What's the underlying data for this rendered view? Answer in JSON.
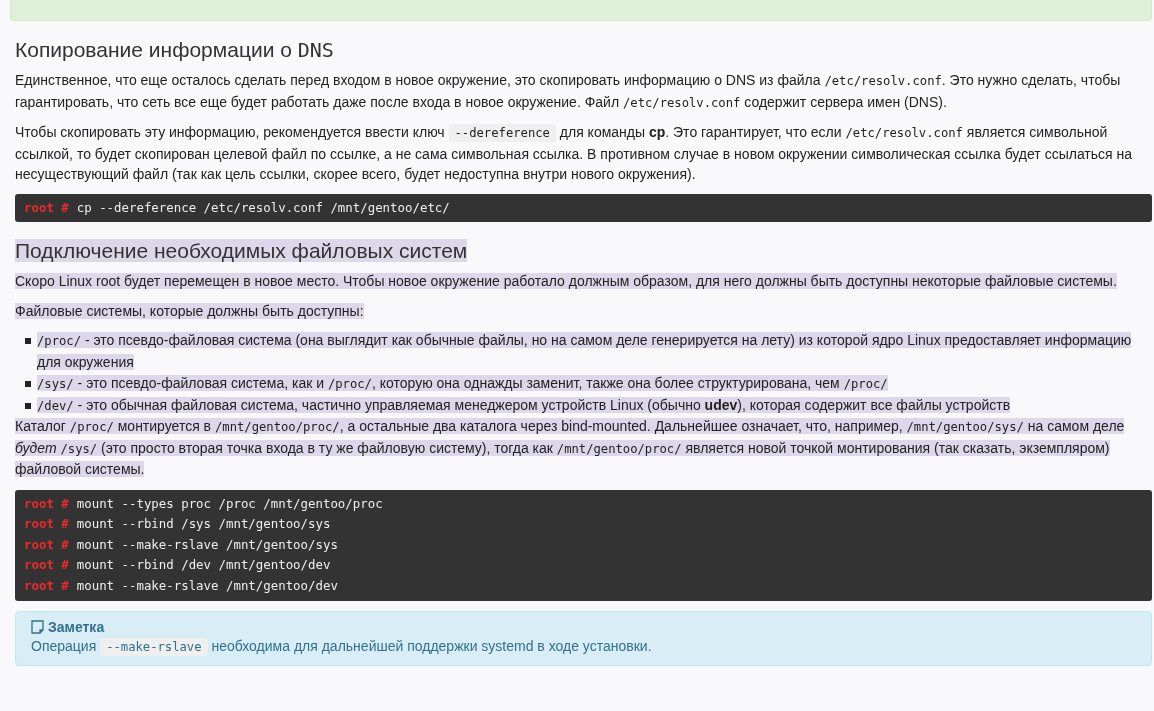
{
  "top_notice": {
    "kind": "success"
  },
  "sections": [
    {
      "highlighted": false,
      "heading": [
        {
          "kind": "text",
          "text": "Копирование информации о "
        },
        {
          "kind": "code",
          "text": "DNS"
        }
      ],
      "blocks": [
        {
          "kind": "paragraph",
          "segments": [
            {
              "kind": "text",
              "text": "Единственное, что еще осталось сделать перед входом в новое окружение, это скопировать информацию о DNS из файла "
            },
            {
              "kind": "code",
              "text": "/etc/resolv.conf"
            },
            {
              "kind": "text",
              "text": ". Это нужно сделать, чтобы гарантировать, что сеть все еще будет работать даже после входа в новое окружение. Файл "
            },
            {
              "kind": "code",
              "text": "/etc/resolv.conf"
            },
            {
              "kind": "text",
              "text": " содержит сервера имен (DNS)."
            }
          ]
        },
        {
          "kind": "paragraph",
          "segments": [
            {
              "kind": "text",
              "text": "Чтобы скопировать эту информацию, рекомендуется ввести ключ "
            },
            {
              "kind": "key",
              "text": "--dereference"
            },
            {
              "kind": "text",
              "text": " для команды "
            },
            {
              "kind": "bold",
              "text": "cp"
            },
            {
              "kind": "text",
              "text": ". Это гарантирует, что если "
            },
            {
              "kind": "code",
              "text": "/etc/resolv.conf"
            },
            {
              "kind": "text",
              "text": " является символьной ссылкой, то будет скопирован целевой файл по ссылке, а не сама символьная ссылка. В противном случае в новом окружении символическая ссылка будет ссылаться на несуществующий файл (так как цель ссылки, скорее всего, будет недоступна внутри нового окружения)."
            }
          ]
        },
        {
          "kind": "code",
          "lines": [
            {
              "prompt": "root #",
              "command": "cp --dereference /etc/resolv.conf /mnt/gentoo/etc/"
            }
          ]
        }
      ]
    },
    {
      "highlighted": true,
      "heading": [
        {
          "kind": "text",
          "text": "Подключение необходимых файловых систем"
        }
      ],
      "blocks": [
        {
          "kind": "paragraph",
          "segments": [
            {
              "kind": "text",
              "text": "Скоро Linux root будет перемещен в новое место. Чтобы новое окружение работало должным образом, для него должны быть доступны некоторые файловые системы."
            }
          ]
        },
        {
          "kind": "paragraph",
          "segments": [
            {
              "kind": "text",
              "text": "Файловые системы, которые должны быть доступны:"
            }
          ]
        },
        {
          "kind": "list",
          "items": [
            {
              "segments": [
                {
                  "kind": "code",
                  "text": "/proc/"
                },
                {
                  "kind": "text",
                  "text": " - это псевдо-файловая система (она выглядит как обычные файлы, но на самом деле генерируется на лету) из которой ядро Linux предоставляет информацию для окружения"
                }
              ]
            },
            {
              "segments": [
                {
                  "kind": "code",
                  "text": "/sys/"
                },
                {
                  "kind": "text",
                  "text": " - это псевдо-файловая система, как и "
                },
                {
                  "kind": "code",
                  "text": "/proc/"
                },
                {
                  "kind": "text",
                  "text": ", которую она однажды заменит, также она более структурирована, чем "
                },
                {
                  "kind": "code",
                  "text": "/proc/"
                }
              ]
            },
            {
              "segments": [
                {
                  "kind": "code",
                  "text": "/dev/"
                },
                {
                  "kind": "text",
                  "text": " - это обычная файловая система, частично управляемая менеджером устройств Linux (обычно "
                },
                {
                  "kind": "bold",
                  "text": "udev"
                },
                {
                  "kind": "text",
                  "text": "), которая содержит все файлы устройств"
                }
              ]
            }
          ]
        },
        {
          "kind": "tight",
          "segments": [
            {
              "kind": "text",
              "text": "Каталог "
            },
            {
              "kind": "code",
              "text": "/proc/"
            },
            {
              "kind": "text",
              "text": " монтируется в "
            },
            {
              "kind": "code",
              "text": "/mnt/gentoo/proc/"
            },
            {
              "kind": "text",
              "text": ", а остальные два каталога через bind-mounted. Дальнейшее означает, что, например, "
            },
            {
              "kind": "code",
              "text": "/mnt/gentoo/sys/"
            },
            {
              "kind": "text",
              "text": " на самом деле "
            },
            {
              "kind": "italic",
              "text": "будет "
            },
            {
              "kind": "code",
              "text": "/sys/"
            },
            {
              "kind": "text",
              "text": " (это просто вторая точка входа в ту же файловую систему), тогда как "
            },
            {
              "kind": "code",
              "text": "/mnt/gentoo/proc/"
            },
            {
              "kind": "text",
              "text": " является новой точкой монтирования (так сказать, экземпляром) файловой системы."
            }
          ]
        },
        {
          "kind": "code",
          "lines": [
            {
              "prompt": "root #",
              "command": "mount --types proc /proc /mnt/gentoo/proc"
            },
            {
              "prompt": "root #",
              "command": "mount --rbind /sys /mnt/gentoo/sys"
            },
            {
              "prompt": "root #",
              "command": "mount --make-rslave /mnt/gentoo/sys"
            },
            {
              "prompt": "root #",
              "command": "mount --rbind /dev /mnt/gentoo/dev"
            },
            {
              "prompt": "root #",
              "command": "mount --make-rslave /mnt/gentoo/dev"
            }
          ]
        },
        {
          "kind": "note",
          "title": "Заметка",
          "segments": [
            {
              "kind": "text",
              "text": "Операция "
            },
            {
              "kind": "key",
              "text": "--make-rslave"
            },
            {
              "kind": "text",
              "text": " необходима для дальнейшей поддержки systemd в ходе установки."
            }
          ]
        }
      ]
    }
  ]
}
